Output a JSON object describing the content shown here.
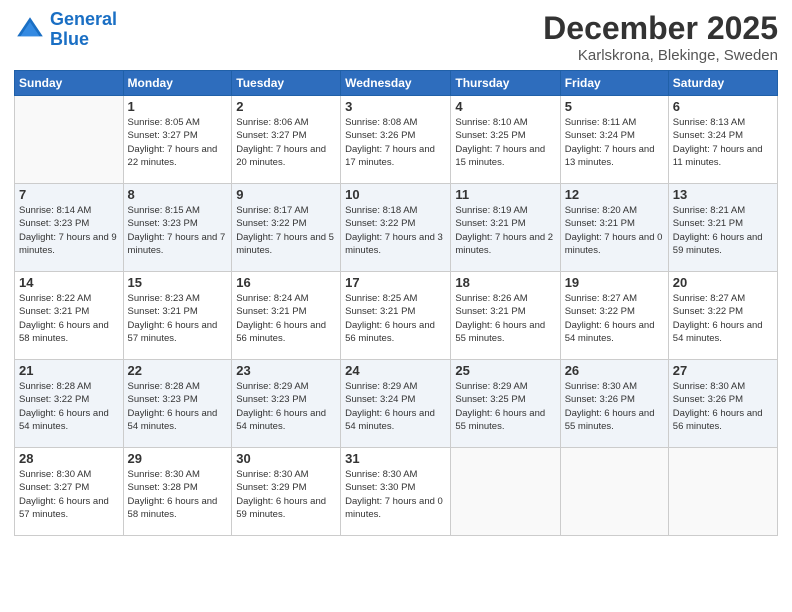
{
  "logo": {
    "line1": "General",
    "line2": "Blue"
  },
  "header": {
    "month": "December 2025",
    "location": "Karlskrona, Blekinge, Sweden"
  },
  "weekdays": [
    "Sunday",
    "Monday",
    "Tuesday",
    "Wednesday",
    "Thursday",
    "Friday",
    "Saturday"
  ],
  "weeks": [
    [
      {
        "day": "",
        "sunrise": "",
        "sunset": "",
        "daylight": ""
      },
      {
        "day": "1",
        "sunrise": "Sunrise: 8:05 AM",
        "sunset": "Sunset: 3:27 PM",
        "daylight": "Daylight: 7 hours and 22 minutes."
      },
      {
        "day": "2",
        "sunrise": "Sunrise: 8:06 AM",
        "sunset": "Sunset: 3:27 PM",
        "daylight": "Daylight: 7 hours and 20 minutes."
      },
      {
        "day": "3",
        "sunrise": "Sunrise: 8:08 AM",
        "sunset": "Sunset: 3:26 PM",
        "daylight": "Daylight: 7 hours and 17 minutes."
      },
      {
        "day": "4",
        "sunrise": "Sunrise: 8:10 AM",
        "sunset": "Sunset: 3:25 PM",
        "daylight": "Daylight: 7 hours and 15 minutes."
      },
      {
        "day": "5",
        "sunrise": "Sunrise: 8:11 AM",
        "sunset": "Sunset: 3:24 PM",
        "daylight": "Daylight: 7 hours and 13 minutes."
      },
      {
        "day": "6",
        "sunrise": "Sunrise: 8:13 AM",
        "sunset": "Sunset: 3:24 PM",
        "daylight": "Daylight: 7 hours and 11 minutes."
      }
    ],
    [
      {
        "day": "7",
        "sunrise": "Sunrise: 8:14 AM",
        "sunset": "Sunset: 3:23 PM",
        "daylight": "Daylight: 7 hours and 9 minutes."
      },
      {
        "day": "8",
        "sunrise": "Sunrise: 8:15 AM",
        "sunset": "Sunset: 3:23 PM",
        "daylight": "Daylight: 7 hours and 7 minutes."
      },
      {
        "day": "9",
        "sunrise": "Sunrise: 8:17 AM",
        "sunset": "Sunset: 3:22 PM",
        "daylight": "Daylight: 7 hours and 5 minutes."
      },
      {
        "day": "10",
        "sunrise": "Sunrise: 8:18 AM",
        "sunset": "Sunset: 3:22 PM",
        "daylight": "Daylight: 7 hours and 3 minutes."
      },
      {
        "day": "11",
        "sunrise": "Sunrise: 8:19 AM",
        "sunset": "Sunset: 3:21 PM",
        "daylight": "Daylight: 7 hours and 2 minutes."
      },
      {
        "day": "12",
        "sunrise": "Sunrise: 8:20 AM",
        "sunset": "Sunset: 3:21 PM",
        "daylight": "Daylight: 7 hours and 0 minutes."
      },
      {
        "day": "13",
        "sunrise": "Sunrise: 8:21 AM",
        "sunset": "Sunset: 3:21 PM",
        "daylight": "Daylight: 6 hours and 59 minutes."
      }
    ],
    [
      {
        "day": "14",
        "sunrise": "Sunrise: 8:22 AM",
        "sunset": "Sunset: 3:21 PM",
        "daylight": "Daylight: 6 hours and 58 minutes."
      },
      {
        "day": "15",
        "sunrise": "Sunrise: 8:23 AM",
        "sunset": "Sunset: 3:21 PM",
        "daylight": "Daylight: 6 hours and 57 minutes."
      },
      {
        "day": "16",
        "sunrise": "Sunrise: 8:24 AM",
        "sunset": "Sunset: 3:21 PM",
        "daylight": "Daylight: 6 hours and 56 minutes."
      },
      {
        "day": "17",
        "sunrise": "Sunrise: 8:25 AM",
        "sunset": "Sunset: 3:21 PM",
        "daylight": "Daylight: 6 hours and 56 minutes."
      },
      {
        "day": "18",
        "sunrise": "Sunrise: 8:26 AM",
        "sunset": "Sunset: 3:21 PM",
        "daylight": "Daylight: 6 hours and 55 minutes."
      },
      {
        "day": "19",
        "sunrise": "Sunrise: 8:27 AM",
        "sunset": "Sunset: 3:22 PM",
        "daylight": "Daylight: 6 hours and 54 minutes."
      },
      {
        "day": "20",
        "sunrise": "Sunrise: 8:27 AM",
        "sunset": "Sunset: 3:22 PM",
        "daylight": "Daylight: 6 hours and 54 minutes."
      }
    ],
    [
      {
        "day": "21",
        "sunrise": "Sunrise: 8:28 AM",
        "sunset": "Sunset: 3:22 PM",
        "daylight": "Daylight: 6 hours and 54 minutes."
      },
      {
        "day": "22",
        "sunrise": "Sunrise: 8:28 AM",
        "sunset": "Sunset: 3:23 PM",
        "daylight": "Daylight: 6 hours and 54 minutes."
      },
      {
        "day": "23",
        "sunrise": "Sunrise: 8:29 AM",
        "sunset": "Sunset: 3:23 PM",
        "daylight": "Daylight: 6 hours and 54 minutes."
      },
      {
        "day": "24",
        "sunrise": "Sunrise: 8:29 AM",
        "sunset": "Sunset: 3:24 PM",
        "daylight": "Daylight: 6 hours and 54 minutes."
      },
      {
        "day": "25",
        "sunrise": "Sunrise: 8:29 AM",
        "sunset": "Sunset: 3:25 PM",
        "daylight": "Daylight: 6 hours and 55 minutes."
      },
      {
        "day": "26",
        "sunrise": "Sunrise: 8:30 AM",
        "sunset": "Sunset: 3:26 PM",
        "daylight": "Daylight: 6 hours and 55 minutes."
      },
      {
        "day": "27",
        "sunrise": "Sunrise: 8:30 AM",
        "sunset": "Sunset: 3:26 PM",
        "daylight": "Daylight: 6 hours and 56 minutes."
      }
    ],
    [
      {
        "day": "28",
        "sunrise": "Sunrise: 8:30 AM",
        "sunset": "Sunset: 3:27 PM",
        "daylight": "Daylight: 6 hours and 57 minutes."
      },
      {
        "day": "29",
        "sunrise": "Sunrise: 8:30 AM",
        "sunset": "Sunset: 3:28 PM",
        "daylight": "Daylight: 6 hours and 58 minutes."
      },
      {
        "day": "30",
        "sunrise": "Sunrise: 8:30 AM",
        "sunset": "Sunset: 3:29 PM",
        "daylight": "Daylight: 6 hours and 59 minutes."
      },
      {
        "day": "31",
        "sunrise": "Sunrise: 8:30 AM",
        "sunset": "Sunset: 3:30 PM",
        "daylight": "Daylight: 7 hours and 0 minutes."
      },
      {
        "day": "",
        "sunrise": "",
        "sunset": "",
        "daylight": ""
      },
      {
        "day": "",
        "sunrise": "",
        "sunset": "",
        "daylight": ""
      },
      {
        "day": "",
        "sunrise": "",
        "sunset": "",
        "daylight": ""
      }
    ]
  ]
}
